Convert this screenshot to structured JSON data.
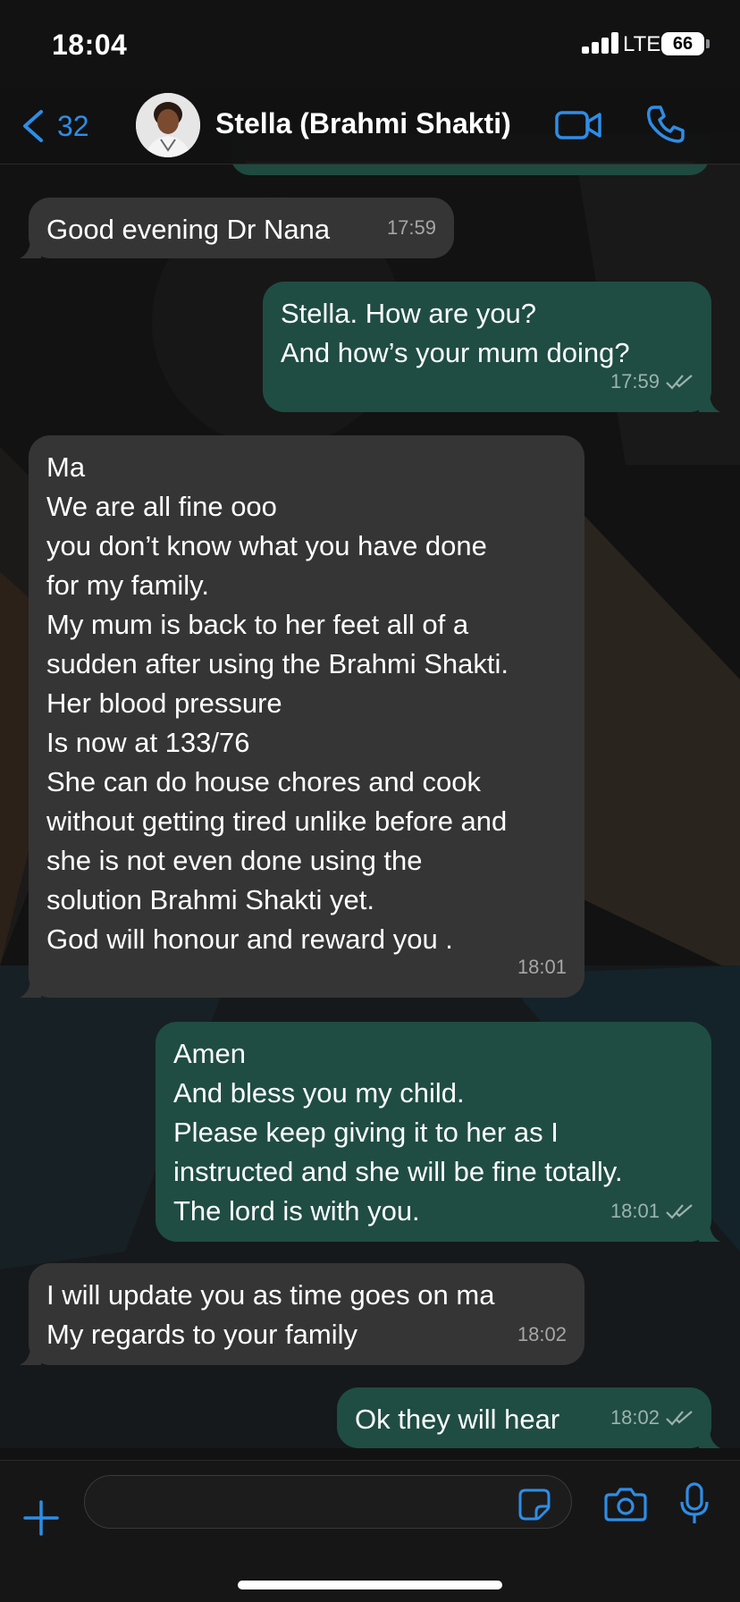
{
  "status_bar": {
    "time": "18:04",
    "network": "LTE",
    "battery": "66",
    "signal_icon": "signal-bars-icon",
    "battery_icon": "battery-icon"
  },
  "header": {
    "back_count": "32",
    "contact_name": "Stella (Brahmi Shakti)",
    "back_icon": "chevron-left-icon",
    "video_icon": "video-camera-icon",
    "call_icon": "phone-icon",
    "accent_color": "#2e8de6"
  },
  "messages": [
    {
      "direction": "incoming",
      "text": "Good evening Dr Nana",
      "time": "17:59",
      "read": false
    },
    {
      "direction": "outgoing",
      "text": "Stella. How are you?\nAnd how’s your mum doing?",
      "time": "17:59",
      "read": true
    },
    {
      "direction": "incoming",
      "text": "Ma\nWe are all fine ooo\nyou don’t know what you have done\nfor my family.\nMy mum is back to her feet all of a\nsudden after using the Brahmi Shakti.\nHer blood pressure\nIs now at 133/76\nShe can do house chores and cook\nwithout getting tired unlike before and\nshe is not even done using the\nsolution Brahmi Shakti yet.\nGod will honour and reward you .",
      "time": "18:01",
      "read": false
    },
    {
      "direction": "outgoing",
      "text": "Amen\nAnd bless you my child.\nPlease keep giving it to her as I\ninstructed and she will be fine totally.\nThe lord is with you.",
      "time": "18:01",
      "read": true
    },
    {
      "direction": "incoming",
      "text": "I will update you as time goes on ma\nMy regards to your family",
      "time": "18:02",
      "read": false
    },
    {
      "direction": "outgoing",
      "text": "Ok they will hear",
      "time": "18:02",
      "read": true
    }
  ],
  "input_bar": {
    "placeholder": "",
    "plus_icon": "plus-icon",
    "sticker_icon": "sticker-icon",
    "camera_icon": "camera-icon",
    "mic_icon": "microphone-icon"
  },
  "colors": {
    "incoming_bubble": "#353535",
    "outgoing_bubble": "#1f4d43",
    "timestamp": "#a6a6a6"
  }
}
